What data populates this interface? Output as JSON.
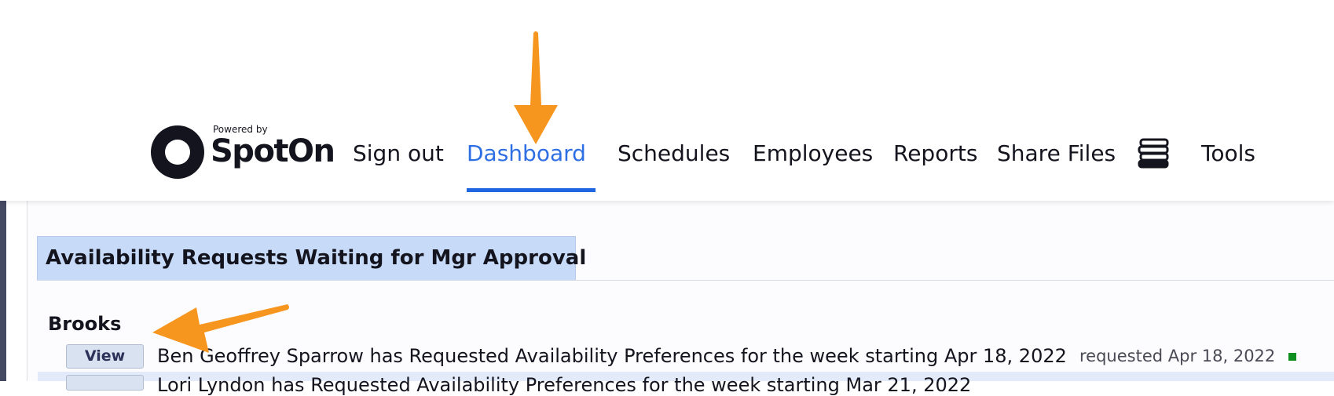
{
  "header": {
    "logo": {
      "powered_by": "Powered by",
      "brand": "SpotOn"
    },
    "nav": [
      {
        "label": "Sign out",
        "active": false
      },
      {
        "label": "Dashboard",
        "active": true
      },
      {
        "label": "Schedules",
        "active": false
      },
      {
        "label": "Employees",
        "active": false
      },
      {
        "label": "Reports",
        "active": false
      },
      {
        "label": "Share Files",
        "active": false
      },
      {
        "label": "Tools",
        "active": false
      }
    ],
    "icons": {
      "library": "books-icon"
    }
  },
  "section": {
    "title": "Availability Requests Waiting for Mgr Approval",
    "location": "Brooks",
    "requests": [
      {
        "button": "View",
        "text": "Ben Geoffrey Sparrow has Requested Availability Preferences for the week starting Apr 18, 2022",
        "requested": "requested Apr 18, 2022",
        "status_color": "#0f8f1f"
      },
      {
        "button": "View",
        "text": "Lori Lyndon has Requested Availability Preferences for the week starting Mar 21, 2022"
      }
    ]
  },
  "colors": {
    "active_nav": "#2f6fe4",
    "section_header": "#c7daf8",
    "annotation_arrow": "#f7961e"
  }
}
